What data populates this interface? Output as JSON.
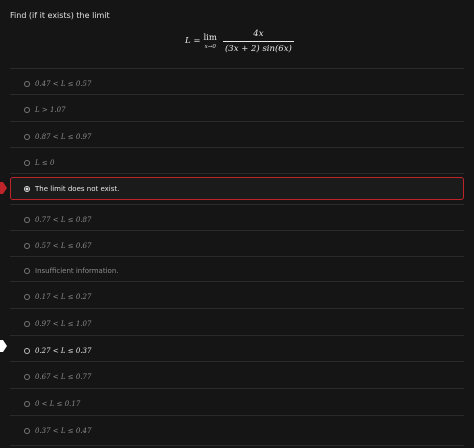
{
  "question": {
    "prompt": "Find (if it exists) the limit",
    "formula": {
      "lhs": "L =",
      "lim_word": "lim",
      "lim_sub": "x→0",
      "numerator": "4x",
      "denominator": "(3x + 2) sin(6x)"
    }
  },
  "options": [
    {
      "label": "0.47 < L ≤ 0.57",
      "selected": false,
      "math": true
    },
    {
      "label": "L > 1.07",
      "selected": false,
      "math": true
    },
    {
      "label": "0.87 < L ≤ 0.97",
      "selected": false,
      "math": true
    },
    {
      "label": "L ≤ 0",
      "selected": false,
      "math": true
    },
    {
      "label": "The limit does not exist.",
      "selected": true,
      "math": false
    },
    {
      "label": "0.77 < L ≤ 0.87",
      "selected": false,
      "math": true
    },
    {
      "label": "0.57 < L ≤ 0.67",
      "selected": false,
      "math": true
    },
    {
      "label": "Insufficient information.",
      "selected": false,
      "math": false
    },
    {
      "label": "0.17 < L ≤ 0.27",
      "selected": false,
      "math": true
    },
    {
      "label": "0.97 < L ≤ 1.07",
      "selected": false,
      "math": true
    },
    {
      "label": "0.27 < L ≤ 0.37",
      "selected": false,
      "math": true
    },
    {
      "label": "0.67 < L ≤ 0.77",
      "selected": false,
      "math": true
    },
    {
      "label": "0 < L ≤ 0.17",
      "selected": false,
      "math": true
    },
    {
      "label": "0.37 < L ≤ 0.47",
      "selected": false,
      "math": true
    }
  ],
  "colors": {
    "background": "#151515",
    "selected_border": "#c0242b",
    "incorrect_marker": "#c0242b",
    "correct_marker": "#ffffff"
  },
  "markers": [
    {
      "option_index": 4,
      "status": "incorrect",
      "icon": "incorrect-marker-icon"
    },
    {
      "option_index": 10,
      "status": "correct",
      "icon": "correct-marker-icon"
    }
  ]
}
